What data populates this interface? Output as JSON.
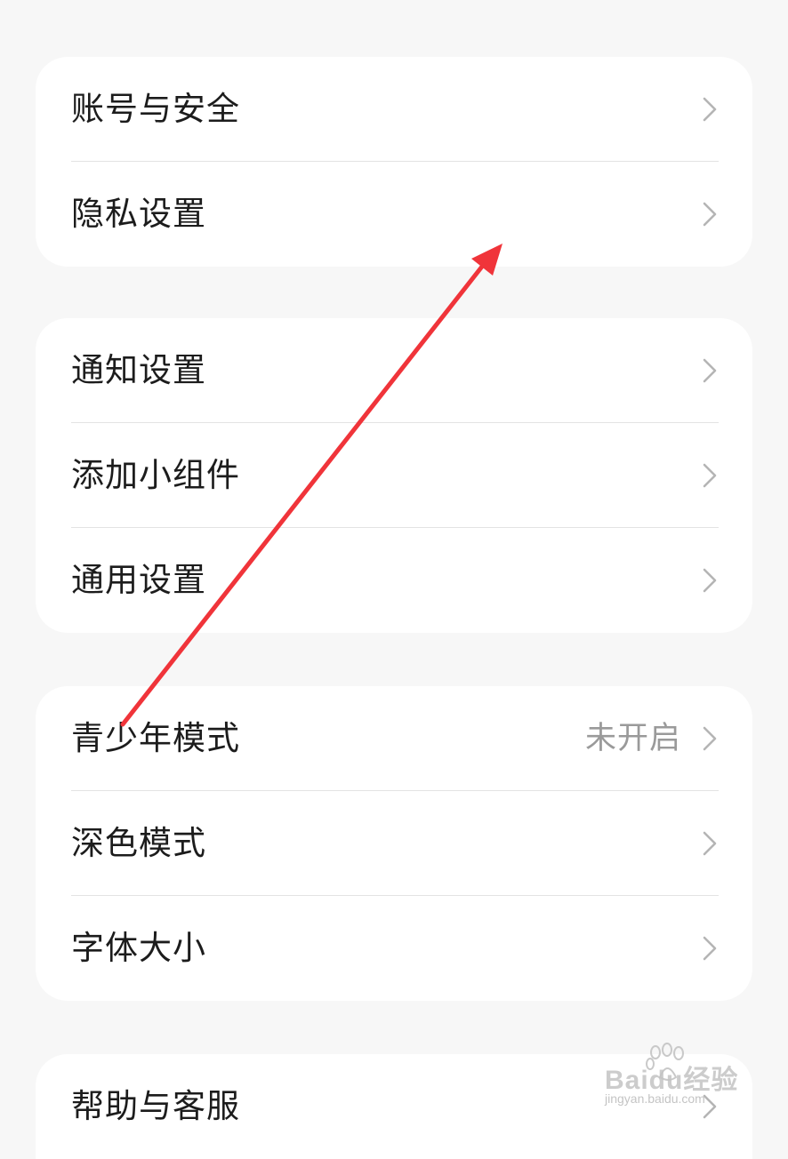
{
  "groups": [
    {
      "items": [
        {
          "label": "账号与安全"
        },
        {
          "label": "隐私设置"
        }
      ]
    },
    {
      "items": [
        {
          "label": "通知设置"
        },
        {
          "label": "添加小组件"
        },
        {
          "label": "通用设置"
        }
      ]
    },
    {
      "items": [
        {
          "label": "青少年模式",
          "value": "未开启"
        },
        {
          "label": "深色模式"
        },
        {
          "label": "字体大小"
        }
      ]
    },
    {
      "items": [
        {
          "label": "帮助与客服"
        }
      ]
    }
  ],
  "chevron_icon": "chevron-right-icon",
  "annotation": {
    "color": "#f0343a",
    "icon": "red-arrow"
  },
  "watermark": {
    "brand": "Baidu经验",
    "url": "jingyan.baidu.com"
  },
  "colors": {
    "background": "#f7f7f7",
    "card": "#ffffff",
    "label": "#1c1c1c",
    "secondary": "#9a9a9a",
    "chevron": "#b5b5b5"
  }
}
